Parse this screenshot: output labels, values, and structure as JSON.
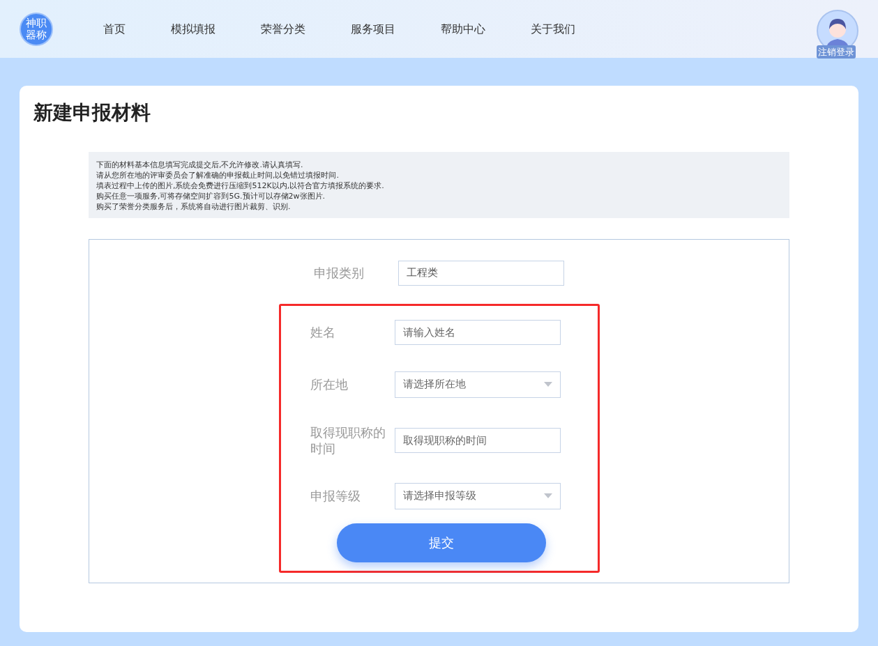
{
  "header": {
    "logo": "神职器称",
    "nav": [
      {
        "label": "首页",
        "selected": false
      },
      {
        "label": "模拟填报",
        "selected": false
      },
      {
        "label": "荣誉分类",
        "selected": false
      },
      {
        "label": "服务项目",
        "selected": false
      },
      {
        "label": "帮助中心",
        "selected": false
      },
      {
        "label": "关于我们",
        "selected": false
      }
    ],
    "user": {
      "logout": "注销登录"
    }
  },
  "page": {
    "title": "新建申报材料",
    "notice": [
      "下面的材料基本信息填写完成提交后,不允许修改.请认真填写.",
      "请从您所在地的评审委员会了解准确的申报截止时间,以免错过填报时间.",
      "填表过程中上传的图片,系统会免费进行压缩到512K以内,以符合官方填报系统的要求.",
      "购买任意一项服务,可将存储空间扩容到5G.预计可以存储2w张图片.",
      "购买了荣誉分类服务后，系统将自动进行图片裁剪、识别."
    ],
    "form": {
      "fields": [
        {
          "kind": "text",
          "label": "申报类别",
          "value": "工程类",
          "highlighted": false
        },
        {
          "kind": "text",
          "label": "姓名",
          "placeholder": "请输入姓名",
          "highlighted": true
        },
        {
          "kind": "select",
          "label": "所在地",
          "placeholder": "请选择所在地",
          "highlighted": true
        },
        {
          "kind": "text",
          "label": "取得现职称的时间",
          "placeholder": "取得现职称的时间",
          "highlighted": true
        },
        {
          "kind": "select",
          "label": "申报等级",
          "placeholder": "请选择申报等级",
          "highlighted": true
        }
      ],
      "submit": {
        "label": "提交",
        "highlighted": true
      }
    }
  }
}
